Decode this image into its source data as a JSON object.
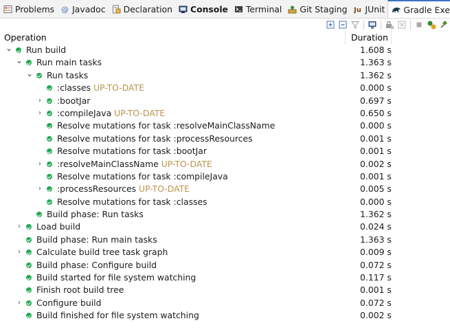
{
  "tabs": [
    {
      "id": "problems",
      "label": "Problems",
      "icon": "problems-icon"
    },
    {
      "id": "javadoc",
      "label": "Javadoc",
      "icon": "javadoc-icon"
    },
    {
      "id": "declaration",
      "label": "Declaration",
      "icon": "declaration-icon"
    },
    {
      "id": "console",
      "label": "Console",
      "icon": "console-icon"
    },
    {
      "id": "terminal",
      "label": "Terminal",
      "icon": "terminal-icon"
    },
    {
      "id": "git-staging",
      "label": "Git Staging",
      "icon": "git-staging-icon"
    },
    {
      "id": "junit",
      "label": "JUnit",
      "icon": "junit-icon"
    },
    {
      "id": "gradle-executions",
      "label": "Gradle Executions",
      "icon": "gradle-icon",
      "active": true
    }
  ],
  "close_glyph": "✕",
  "header": {
    "operation": "Operation",
    "duration": "Duration"
  },
  "rows": [
    {
      "depth": 0,
      "twisty": "expanded",
      "label": "Run build",
      "status": "",
      "duration": "1.608 s"
    },
    {
      "depth": 1,
      "twisty": "expanded",
      "label": "Run main tasks",
      "status": "",
      "duration": "1.363 s"
    },
    {
      "depth": 2,
      "twisty": "expanded",
      "label": "Run tasks",
      "status": "",
      "duration": "1.362 s"
    },
    {
      "depth": 3,
      "twisty": "none",
      "label": ":classes",
      "status": "UP-TO-DATE",
      "duration": "0.000 s"
    },
    {
      "depth": 3,
      "twisty": "collapsed",
      "label": ":bootJar",
      "status": "",
      "duration": "0.697 s"
    },
    {
      "depth": 3,
      "twisty": "collapsed",
      "label": ":compileJava",
      "status": "UP-TO-DATE",
      "duration": "0.650 s"
    },
    {
      "depth": 3,
      "twisty": "none",
      "label": "Resolve mutations for task :resolveMainClassName",
      "status": "",
      "duration": "0.000 s"
    },
    {
      "depth": 3,
      "twisty": "none",
      "label": "Resolve mutations for task :processResources",
      "status": "",
      "duration": "0.001 s"
    },
    {
      "depth": 3,
      "twisty": "none",
      "label": "Resolve mutations for task :bootJar",
      "status": "",
      "duration": "0.001 s"
    },
    {
      "depth": 3,
      "twisty": "collapsed",
      "label": ":resolveMainClassName",
      "status": "UP-TO-DATE",
      "duration": "0.002 s"
    },
    {
      "depth": 3,
      "twisty": "none",
      "label": "Resolve mutations for task :compileJava",
      "status": "",
      "duration": "0.001 s"
    },
    {
      "depth": 3,
      "twisty": "collapsed",
      "label": ":processResources",
      "status": "UP-TO-DATE",
      "duration": "0.005 s"
    },
    {
      "depth": 3,
      "twisty": "none",
      "label": "Resolve mutations for task :classes",
      "status": "",
      "duration": "0.000 s"
    },
    {
      "depth": 2,
      "twisty": "none",
      "label": "Build phase: Run tasks",
      "status": "",
      "duration": "1.362 s"
    },
    {
      "depth": 1,
      "twisty": "collapsed",
      "label": "Load build",
      "status": "",
      "duration": "0.024 s"
    },
    {
      "depth": 1,
      "twisty": "none",
      "label": "Build phase: Run main tasks",
      "status": "",
      "duration": "1.363 s"
    },
    {
      "depth": 1,
      "twisty": "collapsed",
      "label": "Calculate build tree task graph",
      "status": "",
      "duration": "0.009 s"
    },
    {
      "depth": 1,
      "twisty": "none",
      "label": "Build phase: Configure build",
      "status": "",
      "duration": "0.072 s"
    },
    {
      "depth": 1,
      "twisty": "none",
      "label": "Build started for file system watching",
      "status": "",
      "duration": "0.117 s"
    },
    {
      "depth": 1,
      "twisty": "none",
      "label": "Finish root build tree",
      "status": "",
      "duration": "0.001 s"
    },
    {
      "depth": 1,
      "twisty": "collapsed",
      "label": "Configure build",
      "status": "",
      "duration": "0.072 s"
    },
    {
      "depth": 1,
      "twisty": "none",
      "label": "Build finished for file system watching",
      "status": "",
      "duration": "0.002 s"
    }
  ],
  "twisty_glyphs": {
    "expanded": "⌄",
    "collapsed": "›"
  },
  "toolbar_icons": [
    "expand-all-icon",
    "collapse-all-icon",
    "filter-icon",
    "link-with-console-icon",
    "rerun-icon",
    "cancel-icon",
    "stop-icon",
    "run-gradle-icon",
    "pin-icon"
  ],
  "colors": {
    "success": "#1fa84f",
    "up_to_date": "#b8934c",
    "active_tab_accent": "#3a73c4"
  }
}
